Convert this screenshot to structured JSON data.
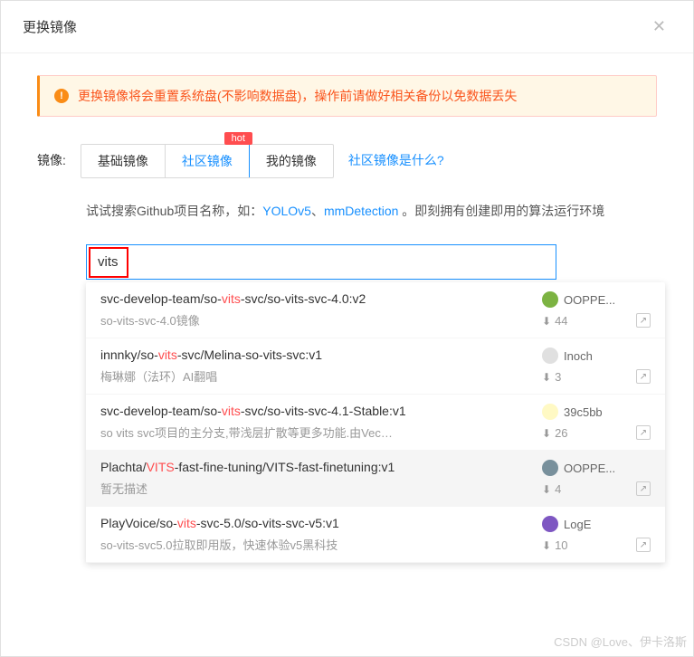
{
  "modal": {
    "title": "更换镜像",
    "alert": "更换镜像将会重置系统盘(不影响数据盘)，操作前请做好相关备份以免数据丢失"
  },
  "form": {
    "label": "镜像:",
    "tabs": [
      "基础镜像",
      "社区镜像",
      "我的镜像"
    ],
    "hot_badge": "hot",
    "help_link": "社区镜像是什么?"
  },
  "hint": {
    "prefix": "试试搜索Github项目名称，如：",
    "link1": "YOLOv5",
    "sep": "、",
    "link2": "mmDetection",
    "suffix": " 。即刻拥有创建即用的算法运行环境"
  },
  "search": {
    "value": "vits"
  },
  "results": [
    {
      "title_parts": [
        "svc-develop-team/so-",
        "vits",
        "-svc/so-vits-svc-4.0:v2"
      ],
      "desc": "so-vits-svc-4.0镜像",
      "author": "OOPPE...",
      "avatar_color": "#7cb342",
      "downloads": "44"
    },
    {
      "title_parts": [
        "innnky/so-",
        "vits",
        "-svc/Melina-so-vits-svc:v1"
      ],
      "desc": "梅琳娜（法环）AI翻唱",
      "author": "Inoch",
      "avatar_color": "#e0e0e0",
      "downloads": "3"
    },
    {
      "title_parts": [
        "svc-develop-team/so-",
        "vits",
        "-svc/so-vits-svc-4.1-Stable:v1"
      ],
      "desc": "so vits svc项目的主分支,带浅层扩散等更多功能.由Vec…",
      "author": "39c5bb",
      "avatar_color": "#fff9c4",
      "downloads": "26"
    },
    {
      "title_parts": [
        "Plachta/",
        "VITS",
        "-fast-fine-tuning/VITS-fast-finetuning:v1"
      ],
      "desc": "暂无描述",
      "author": "OOPPE...",
      "avatar_color": "#78909c",
      "downloads": "4",
      "highlighted": true
    },
    {
      "title_parts": [
        "PlayVoice/so-",
        "vits",
        "-svc-5.0/so-vits-svc-v5:v1"
      ],
      "desc": "so-vits-svc5.0拉取即用版，快速体验v5黑科技",
      "author": "LogE",
      "avatar_color": "#7e57c2",
      "downloads": "10"
    }
  ],
  "watermark": "CSDN @Love、伊卡洛斯"
}
